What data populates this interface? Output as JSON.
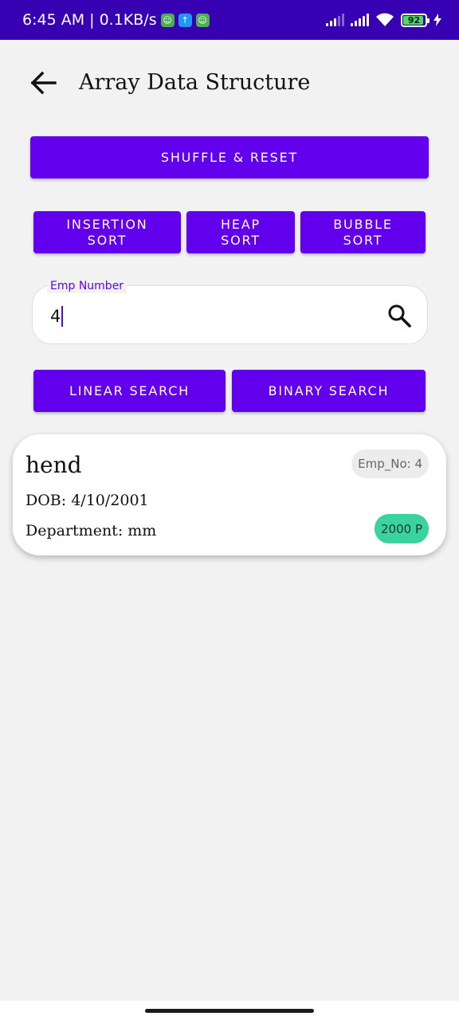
{
  "status_bar": {
    "time_speed": "6:45 AM | 0.1KB/s",
    "battery_level": "92",
    "battery_fraction": 0.92,
    "notification_icons": [
      "android-icon",
      "upload-icon",
      "android-icon"
    ]
  },
  "header": {
    "title": "Array Data Structure"
  },
  "actions": {
    "shuffle_reset": "SHUFFLE & RESET",
    "insertion_sort": [
      "INSERTION",
      "SORT"
    ],
    "heap_sort": [
      "HEAP",
      "SORT"
    ],
    "bubble_sort": [
      "BUBBLE",
      "SORT"
    ],
    "linear_search": "LINEAR SEARCH",
    "binary_search": "BINARY SEARCH"
  },
  "search": {
    "label": "Emp Number",
    "value": "4"
  },
  "result_card": {
    "name": "hend",
    "dob": "DOB: 4/10/2001",
    "department": "Department: mm",
    "emp_no": "Emp_No: 4",
    "salary": "2000 P"
  },
  "colors": {
    "primary": "#6200ee",
    "status_bar": "#3700b3",
    "salary_chip": "#3ad29f",
    "background": "#f2f2f2"
  }
}
